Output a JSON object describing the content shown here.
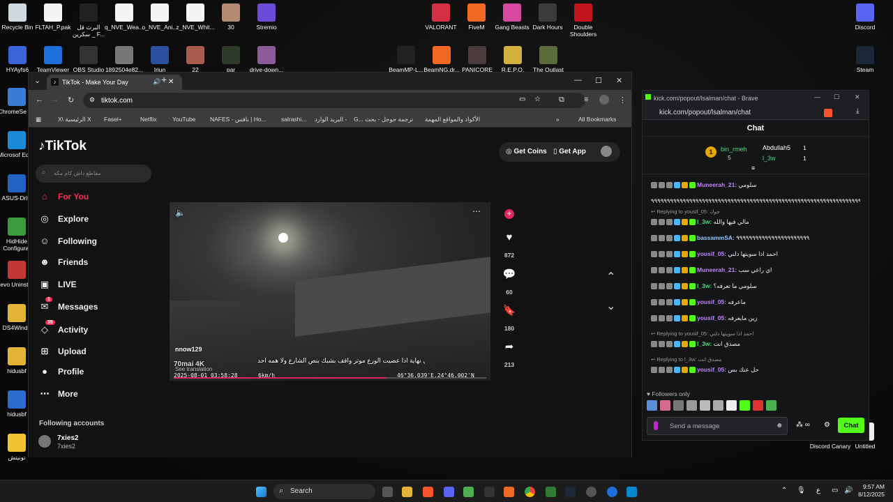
{
  "desktop": {
    "icons_top": [
      {
        "label": "Recycle Bin",
        "color": "#cfd8dc"
      },
      {
        "label": "FLTAH_P.pak",
        "color": "#f5f5f5"
      },
      {
        "label": "البرث قل سكرين _ F...",
        "color": "#222"
      },
      {
        "label": "q_NVE_Wea...",
        "color": "#f5f5f5"
      },
      {
        "label": "o_NVE_Ani...",
        "color": "#f5f5f5"
      },
      {
        "label": "z_NVE_Whit...",
        "color": "#f5f5f5"
      },
      {
        "label": "30",
        "color": "#b48a72"
      },
      {
        "label": "Stremio",
        "color": "#6a4bd8"
      }
    ],
    "icons_top2": [
      {
        "label": "HYAyfs6",
        "color": "#3a64d8"
      },
      {
        "label": "TeamViewer",
        "color": "#1e6fd9"
      },
      {
        "label": "OBS Studio",
        "color": "#333"
      },
      {
        "label": "1892504e82...",
        "color": "#777"
      },
      {
        "label": "Iriun",
        "color": "#2c4fa0"
      },
      {
        "label": "22",
        "color": "#a85c4c"
      },
      {
        "label": "par",
        "color": "#2f3b2a"
      },
      {
        "label": "drive-down...",
        "color": "#8c5b9c"
      }
    ],
    "icons_right": [
      {
        "label": "VALORANT",
        "color": "#d32f45"
      },
      {
        "label": "FiveM",
        "color": "#f06a23"
      },
      {
        "label": "Gang Beasts",
        "color": "#d54a9e"
      },
      {
        "label": "Dark Hours",
        "color": "#3b3b3b"
      },
      {
        "label": "Double Shoulders",
        "color": "#c0151e"
      }
    ],
    "icons_right2": [
      {
        "label": "BeamMP-L...",
        "color": "#222"
      },
      {
        "label": "BeamNG.dr...",
        "color": "#f26722"
      },
      {
        "label": "PANICORE",
        "color": "#4a3c3c"
      },
      {
        "label": "R.E.P.O.",
        "color": "#d3b03c"
      },
      {
        "label": "The Outlast",
        "color": "#5b6b3a"
      }
    ],
    "icons_left": [
      {
        "label": "ChromeSe (1)",
        "color": "#3a7bd5"
      },
      {
        "label": "Microsof Edge",
        "color": "#1b8bd8"
      },
      {
        "label": "ASUS-Drivi",
        "color": "#2162c4"
      },
      {
        "label": "HidHide Configurat",
        "color": "#3c9a3c"
      },
      {
        "label": "Revo Uninstalle",
        "color": "#c43535"
      },
      {
        "label": "DS4Windo",
        "color": "#e3b338"
      },
      {
        "label": "hidusbf",
        "color": "#e3b338"
      },
      {
        "label": "hidusbf",
        "color": "#2e6bd0"
      },
      {
        "label": "تونيتش",
        "color": "#f1c232"
      }
    ],
    "icons_far_right": [
      {
        "label": "Discord",
        "color": "#5865f2"
      },
      {
        "label": "Steam",
        "color": "#1b2838"
      },
      {
        "label": "Discord Canary",
        "color": "#e3b338"
      },
      {
        "label": "Untitled",
        "color": "#eee"
      }
    ]
  },
  "browser": {
    "tab_title": "TikTok - Make Your Day",
    "url": "tiktok.com",
    "bookmarks": [
      "X\\ الرئيسية X",
      "Fasel+",
      "Netflix",
      "YouTube",
      "NAFES - نافس | Ho...",
      "salrashi...",
      "البريد الوارد -",
      "G... ترجمة جوجل - بحث",
      "الأكواد والمواقع المهمة",
      "All Bookmarks"
    ]
  },
  "tiktok": {
    "logo": "TikTok",
    "search_placeholder": "مقاطع داش كام مكه",
    "get_coins": "Get Coins",
    "get_app": "Get App",
    "nav": [
      {
        "label": "For You",
        "icon": "home-icon",
        "active": true
      },
      {
        "label": "Explore",
        "icon": "compass-icon"
      },
      {
        "label": "Following",
        "icon": "following-icon"
      },
      {
        "label": "Friends",
        "icon": "friends-icon"
      },
      {
        "label": "LIVE",
        "icon": "live-icon"
      },
      {
        "label": "Messages",
        "icon": "messages-icon",
        "badge": "1"
      },
      {
        "label": "Activity",
        "icon": "activity-icon",
        "badge": "35"
      },
      {
        "label": "Upload",
        "icon": "upload-icon"
      },
      {
        "label": "Profile",
        "icon": "profile-icon"
      },
      {
        "label": "More",
        "icon": "more-icon"
      }
    ],
    "following_header": "Following accounts",
    "following_user": "7xies2",
    "following_handle": "7xies2",
    "video": {
      "author": "nnow129",
      "caption": "هذي نهاية اذا عصيت الورع موتر واقف بشبك بنص الشارع ولا همه احد 🫡 #Riyadh #داش_كام",
      "see_translation": "See translation",
      "watermark": "70mai 4K",
      "timestamp": "2025-08-01 03:58:28",
      "speed": "6km/h",
      "coords": "46°36.039'E,24°46.002'N",
      "progress": 0.68
    },
    "actions": {
      "likes": "872",
      "comments": "60",
      "saves": "180",
      "shares": "213"
    }
  },
  "kick": {
    "window_title": "kick.com/popout/lsalman/chat - Brave",
    "url": "kick.com/popout/lsalman/chat",
    "chat_header": "Chat",
    "top_gifters": [
      {
        "name": "bin_rmeh",
        "count": "5"
      },
      {
        "name": "Abdullah5",
        "count": "1"
      },
      {
        "name": "l_3w",
        "count": "1"
      }
    ],
    "messages": [
      {
        "user": "Muneerah_21",
        "color": "#c084fc",
        "text": "سلومي",
        "reply": ""
      },
      {
        "user": "",
        "color": "#eee",
        "text": "٩٩٩٩٩٩٩٩٩٩٩٩٩٩٩٩٩٩٩٩٩٩٩٩٩٩٩٩٩٩٩٩٩٩٩٩٩٩٩٩٩٩٩٩٩٩٩٩٩٩٩٩٩٩٩٩٩٩٩٩٩٩٩٩٩٩٩٩٩٩٩٩٩٩",
        "reply": ""
      },
      {
        "user": "l_3w",
        "color": "#4ade80",
        "text": "مالي فيها والله",
        "reply": "Replying to yousif_05: جوك"
      },
      {
        "user": "bassammSA",
        "color": "#93c5fd",
        "text": "٩٩٩٩٩٩٩٩٩٩٩٩٩٩٩٩٩٩٩٩٩٩٩",
        "reply": ""
      },
      {
        "user": "yousif_05",
        "color": "#c084fc",
        "text": "احمد اذا سويتها دلني",
        "reply": ""
      },
      {
        "user": "Muneerah_21",
        "color": "#c084fc",
        "text": "اي راعي سب",
        "reply": ""
      },
      {
        "user": "l_3w",
        "color": "#4ade80",
        "text": "سلومي ما تعرفه؟",
        "reply": ""
      },
      {
        "user": "yousif_05",
        "color": "#c084fc",
        "text": "ماعرفه",
        "reply": ""
      },
      {
        "user": "yousif_05",
        "color": "#c084fc",
        "text": "زين مايعرفه",
        "reply": ""
      },
      {
        "user": "l_3w",
        "color": "#4ade80",
        "text": "مصدق انت",
        "reply": "Replying to yousif_05: احمد اذا سويتها دلني"
      },
      {
        "user": "yousif_05",
        "color": "#c084fc",
        "text": "حل عنك بس",
        "reply": "Replying to l_3w: مصدق انت"
      }
    ],
    "followers_only": "Followers only",
    "send_placeholder": "Send a message",
    "chat_button": "Chat"
  },
  "taskbar": {
    "search": "Search",
    "time": "9:57 AM",
    "date": "8/12/2025",
    "lang": "ع"
  }
}
